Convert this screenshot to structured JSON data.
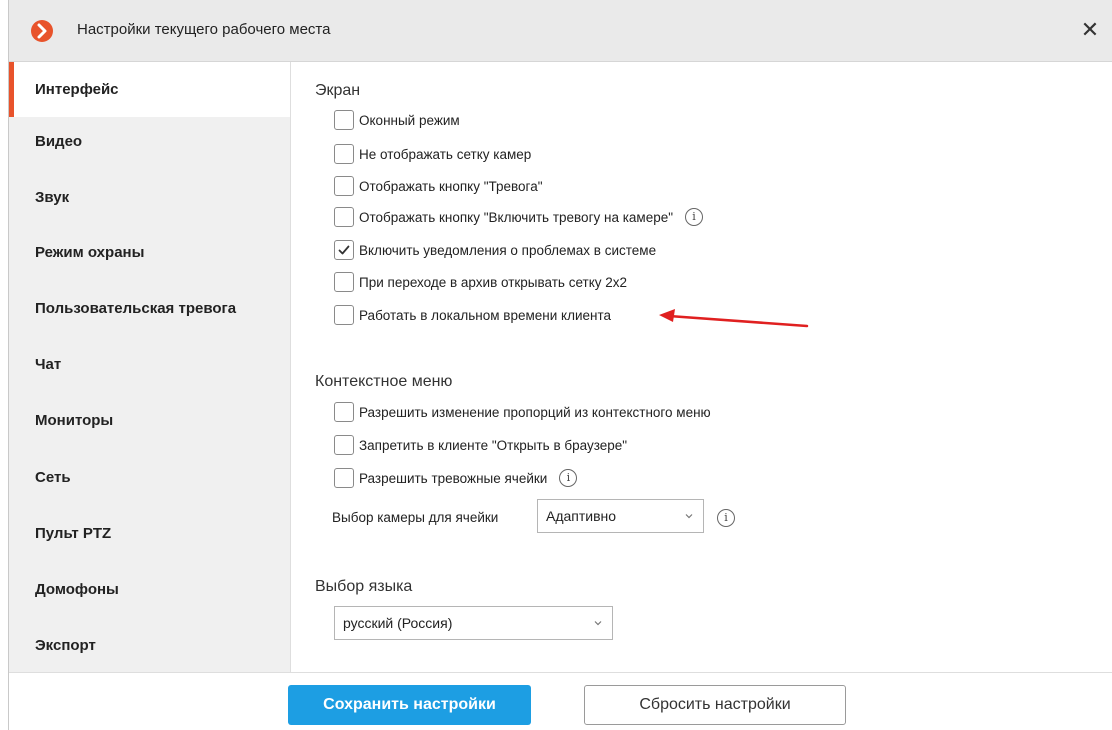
{
  "window": {
    "title": "Настройки текущего рабочего места",
    "logo_icon": "app-logo-icon",
    "close_label": "✕"
  },
  "sidebar": {
    "items": [
      {
        "label": "Интерфейс",
        "active": true
      },
      {
        "label": "Видео",
        "active": false
      },
      {
        "label": "Звук",
        "active": false
      },
      {
        "label": "Режим охраны",
        "active": false
      },
      {
        "label": "Пользовательская тревога",
        "active": false
      },
      {
        "label": "Чат",
        "active": false
      },
      {
        "label": "Мониторы",
        "active": false
      },
      {
        "label": "Сеть",
        "active": false
      },
      {
        "label": "Пульт PTZ",
        "active": false
      },
      {
        "label": "Домофоны",
        "active": false
      },
      {
        "label": "Экспорт",
        "active": false
      }
    ]
  },
  "screen": {
    "heading": "Экран",
    "options": [
      {
        "label": "Оконный режим",
        "checked": false
      },
      {
        "label": "Не отображать сетку камер",
        "checked": false
      },
      {
        "label": "Отображать кнопку \"Тревога\"",
        "checked": false
      },
      {
        "label": "Отображать кнопку \"Включить тревогу на камере\"",
        "checked": false,
        "info": true
      },
      {
        "label": "Включить уведомления о проблемах в системе",
        "checked": true
      },
      {
        "label": "При переходе в архив открывать сетку 2x2",
        "checked": false
      },
      {
        "label": "Работать в локальном времени клиента",
        "checked": false
      }
    ]
  },
  "context_menu": {
    "heading": "Контекстное меню",
    "options": [
      {
        "label": "Разрешить изменение пропорций из контекстного меню",
        "checked": false
      },
      {
        "label": "Запретить в клиенте \"Открыть в браузере\"",
        "checked": false
      },
      {
        "label": "Разрешить тревожные ячейки",
        "checked": false,
        "info": true
      }
    ],
    "camera_select_label": "Выбор камеры для ячейки",
    "camera_select_value": "Адаптивно"
  },
  "language": {
    "heading": "Выбор языка",
    "value": "русский (Россия)"
  },
  "footer": {
    "save_label": "Сохранить настройки",
    "reset_label": "Сбросить настройки"
  },
  "colors": {
    "accent": "#e8532b",
    "primary_button": "#1d9ee3",
    "annotation_arrow": "#e02020"
  },
  "info_glyph": "i"
}
